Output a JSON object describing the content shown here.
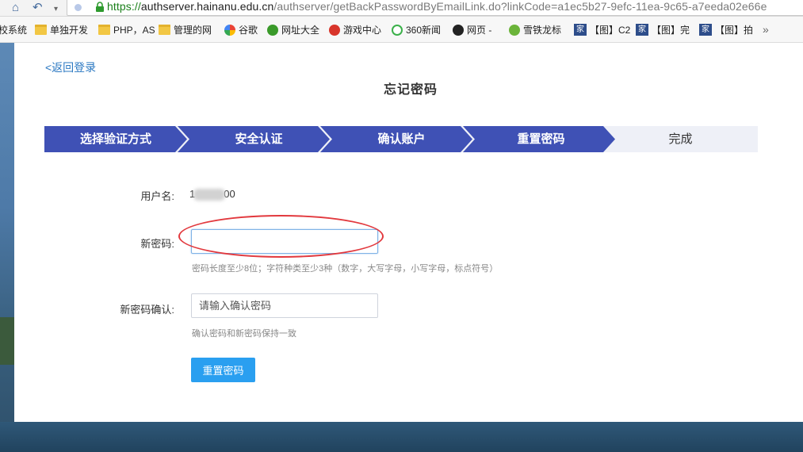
{
  "browser": {
    "url_scheme": "https://",
    "url_host": "authserver.hainanu.edu.cn",
    "url_path": "/authserver/getBackPasswordByEmailLink.do?linkCode=a1ec5b27-9efc-11ea-9c65-a7eeda02e66e",
    "bookmarks": [
      {
        "label": "校系统",
        "icon": "none"
      },
      {
        "label": "单独开发",
        "icon": "folder-icon"
      },
      {
        "label": "PHP，AS",
        "icon": "folder-icon"
      },
      {
        "label": "管理的网",
        "icon": "folder-icon"
      },
      {
        "label": "谷歌",
        "icon": "google-icon"
      },
      {
        "label": "网址大全",
        "icon": "web-directory-icon"
      },
      {
        "label": "游戏中心",
        "icon": "game-center-icon"
      },
      {
        "label": "360新闻",
        "icon": "news-360-icon"
      },
      {
        "label": "网页 -",
        "icon": "webpage-icon"
      },
      {
        "label": "雪铁龙标",
        "icon": "citroen-icon"
      },
      {
        "label": "【图】C2",
        "icon": "jia-icon"
      },
      {
        "label": "【图】完",
        "icon": "jia-icon"
      },
      {
        "label": "【图】拍",
        "icon": "jia-icon"
      }
    ],
    "overflow_glyph": "»"
  },
  "page": {
    "back_link": "<返回登录",
    "title": "忘记密码"
  },
  "steps": [
    {
      "label": "选择验证方式",
      "state": "done"
    },
    {
      "label": "安全认证",
      "state": "done"
    },
    {
      "label": "确认账户",
      "state": "done"
    },
    {
      "label": "重置密码",
      "state": "current"
    },
    {
      "label": "完成",
      "state": "pending"
    }
  ],
  "form": {
    "username_label": "用户名:",
    "username_value_start": "1",
    "username_value_end": "00",
    "new_password_label": "新密码:",
    "new_password_value": "",
    "new_password_hint": "密码长度至少8位；字符种类至少3种（数字，大写字母，小写字母，标点符号）",
    "confirm_label": "新密码确认:",
    "confirm_placeholder": "请输入确认密码",
    "confirm_hint": "确认密码和新密码保持一致",
    "submit_label": "重置密码"
  },
  "colors": {
    "step_active": "#3f51b5",
    "step_pending": "#eef0f7",
    "button": "#2a9ff0",
    "link": "#2b78c2",
    "annotation": "#e2393e"
  }
}
